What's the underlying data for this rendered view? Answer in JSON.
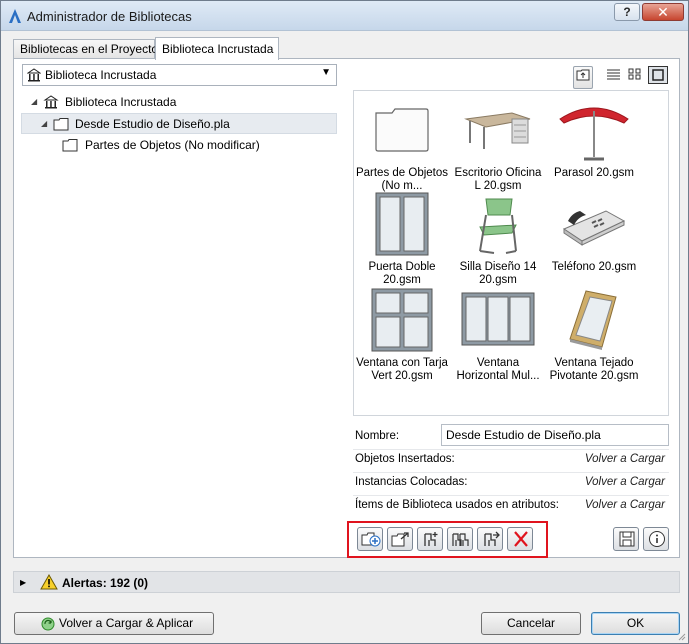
{
  "window": {
    "title": "Administrador de Bibliotecas",
    "help_label": "?",
    "close_label": "✕"
  },
  "tabs": [
    {
      "label": "Bibliotecas en el Proyecto",
      "active": false
    },
    {
      "label": "Biblioteca Incrustada",
      "active": true
    }
  ],
  "library_select": {
    "value": "Biblioteca Incrustada"
  },
  "tree": [
    {
      "label": "Biblioteca Incrustada",
      "icon": "library-icon",
      "level": 0,
      "expanded": true
    },
    {
      "label": "Desde Estudio de Diseño.pla",
      "icon": "folder-icon",
      "level": 1,
      "expanded": true,
      "selected": true
    },
    {
      "label": "Partes de Objetos (No modificar)",
      "icon": "folder-icon",
      "level": 2
    }
  ],
  "view_tools": [
    "up-folder-icon",
    "list-view-icon",
    "small-icons-view-icon",
    "large-icons-view-icon"
  ],
  "items": [
    {
      "caption": "Partes de Objetos (No m...",
      "icon": "folder-icon"
    },
    {
      "caption": "Escritorio Oficina L 20.gsm",
      "icon": "desk-icon"
    },
    {
      "caption": "Parasol 20.gsm",
      "icon": "parasol-icon"
    },
    {
      "caption": "Puerta Doble 20.gsm",
      "icon": "door-icon"
    },
    {
      "caption": "Silla Diseño 14 20.gsm",
      "icon": "chair-icon"
    },
    {
      "caption": "Teléfono 20.gsm",
      "icon": "telephone-icon"
    },
    {
      "caption": "Ventana con Tarja Vert 20.gsm",
      "icon": "window-icon"
    },
    {
      "caption": "Ventana Horizontal Mul...",
      "icon": "window-horizontal-icon"
    },
    {
      "caption": "Ventana Tejado Pivotante 20.gsm",
      "icon": "roof-window-icon"
    }
  ],
  "details": {
    "name_label": "Nombre:",
    "name_value": "Desde Estudio de Diseño.pla",
    "rows": [
      {
        "label": "Objetos Insertados:",
        "value": "Volver a Cargar"
      },
      {
        "label": "Instancias Colocadas:",
        "value": "Volver a Cargar"
      },
      {
        "label": "Ítems de Biblioteca usados en atributos:",
        "value": "Volver a Cargar"
      }
    ]
  },
  "action_buttons": [
    "new-folder-icon",
    "import-folder-icon",
    "add-object-icon",
    "multi-object-icon",
    "export-object-icon",
    "delete-icon"
  ],
  "side_buttons": [
    "save-icon",
    "info-icon"
  ],
  "alerts": {
    "label": "Alertas: 192 (0)"
  },
  "footer": {
    "reload_apply": "Volver a Cargar & Aplicar",
    "cancel": "Cancelar",
    "ok": "OK"
  },
  "colors": {
    "highlight_box": "#e0141e",
    "delete_red": "#e0141e"
  }
}
